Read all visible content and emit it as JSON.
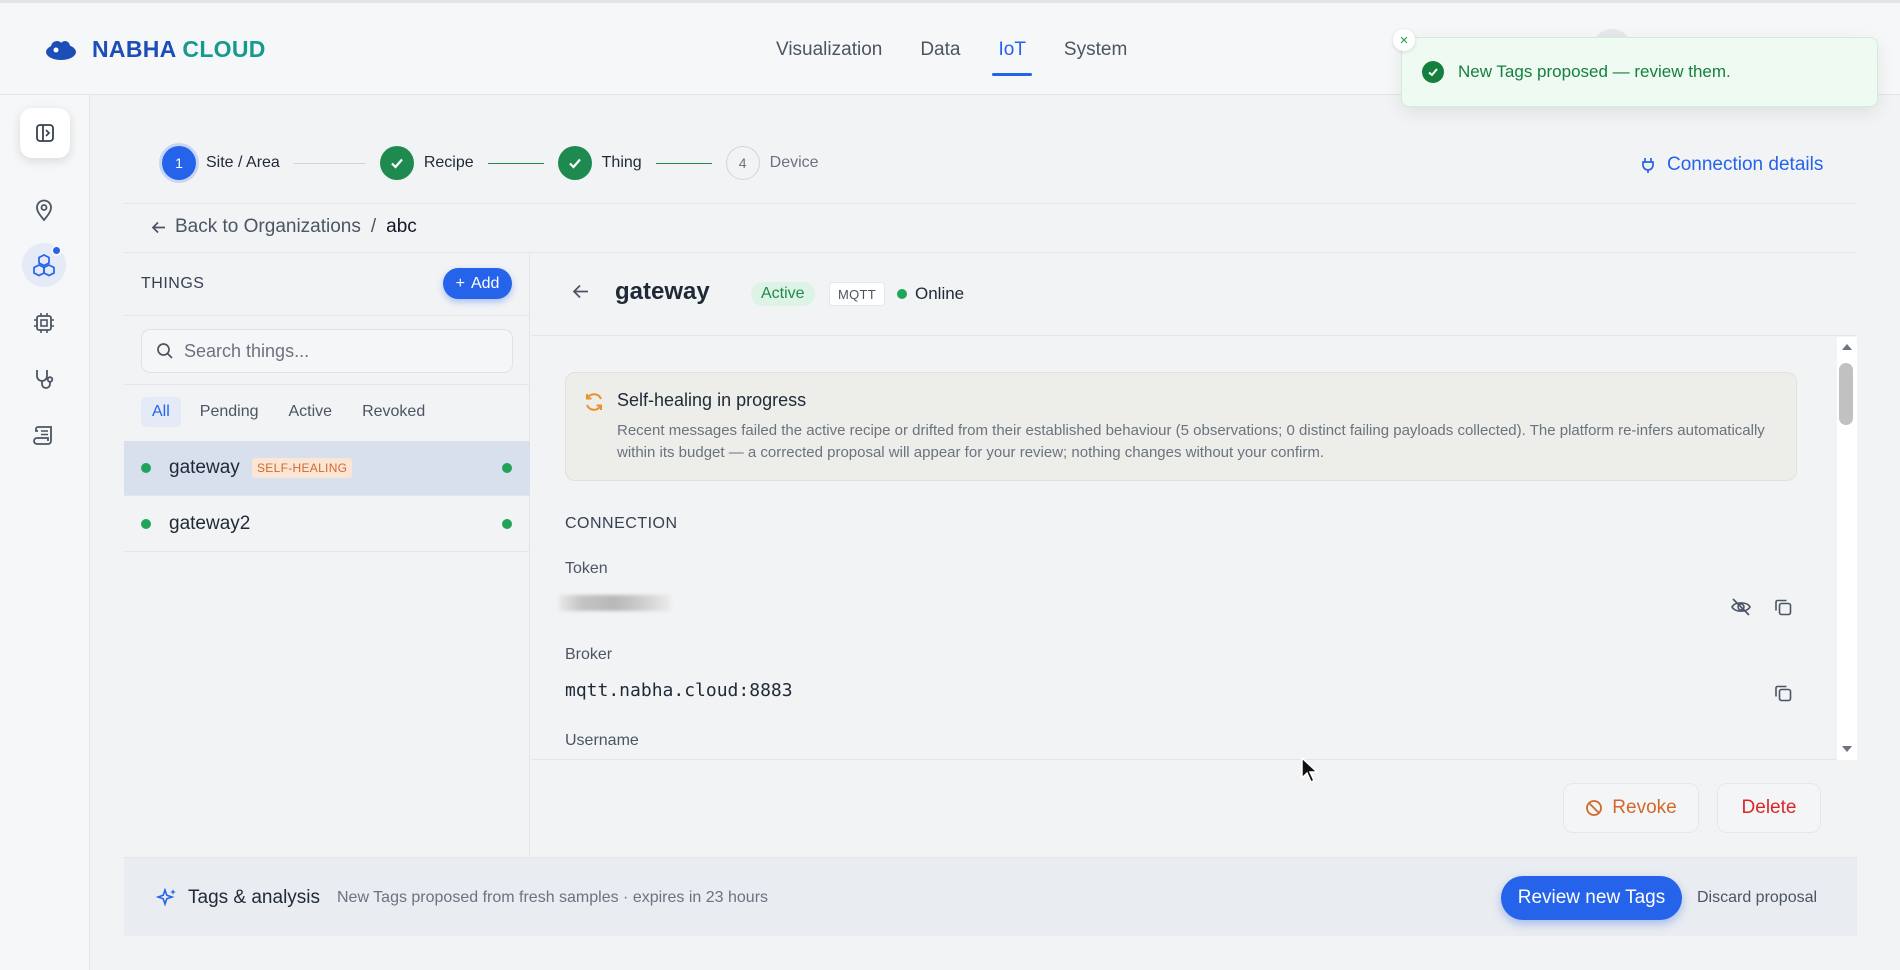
{
  "brand": {
    "name_a": "NABHA",
    "name_b": "CLOUD"
  },
  "nav": {
    "items": [
      "Visualization",
      "Data",
      "IoT",
      "System"
    ],
    "active": "IoT"
  },
  "toast": {
    "message": "New Tags proposed — review them."
  },
  "stepper": {
    "steps": [
      {
        "num": "1",
        "label": "Site / Area",
        "state": "current"
      },
      {
        "num": "",
        "label": "Recipe",
        "state": "done"
      },
      {
        "num": "",
        "label": "Thing",
        "state": "done"
      },
      {
        "num": "4",
        "label": "Device",
        "state": "todo"
      }
    ],
    "connection_link": "Connection details"
  },
  "breadcrumb": {
    "back": "Back to Organizations",
    "separator": "/",
    "current": "abc"
  },
  "things": {
    "title": "THINGS",
    "add_label": "Add",
    "search_placeholder": "Search things...",
    "filters": [
      "All",
      "Pending",
      "Active",
      "Revoked"
    ],
    "active_filter": "All",
    "items": [
      {
        "name": "gateway",
        "badge": "SELF-HEALING",
        "selected": true
      },
      {
        "name": "gateway2",
        "badge": "",
        "selected": false
      }
    ]
  },
  "detail": {
    "title": "gateway",
    "status_badge": "Active",
    "protocol_badge": "MQTT",
    "online_label": "Online",
    "alert": {
      "title": "Self-healing in progress",
      "body": "Recent messages failed the active recipe or drifted from their established behaviour (5 observations; 0 distinct failing payloads collected). The platform re-infers automatically within its budget — a corrected proposal will appear for your review; nothing changes without your confirm."
    },
    "connection": {
      "section_title": "CONNECTION",
      "token_label": "Token",
      "broker_label": "Broker",
      "broker_value": "mqtt.nabha.cloud:8883",
      "username_label": "Username"
    },
    "actions": {
      "revoke": "Revoke",
      "delete": "Delete"
    }
  },
  "tags_bar": {
    "title": "Tags & analysis",
    "subtitle": "New Tags proposed from fresh samples  · expires in 23 hours",
    "review_button": "Review new Tags",
    "discard": "Discard proposal"
  },
  "colors": {
    "accent": "#2563eb",
    "success": "#1f8a50",
    "warning": "#d2692c",
    "danger": "#dc2626"
  },
  "icons": [
    "sidebar-toggle-icon",
    "map-pin-icon",
    "cubes-icon",
    "chip-icon",
    "stethoscope-icon",
    "scroll-icon",
    "plug-icon",
    "arrow-left-icon",
    "search-icon",
    "refresh-icon",
    "eye-off-icon",
    "copy-icon",
    "ban-icon",
    "sparkle-icon",
    "check-icon",
    "close-icon"
  ]
}
